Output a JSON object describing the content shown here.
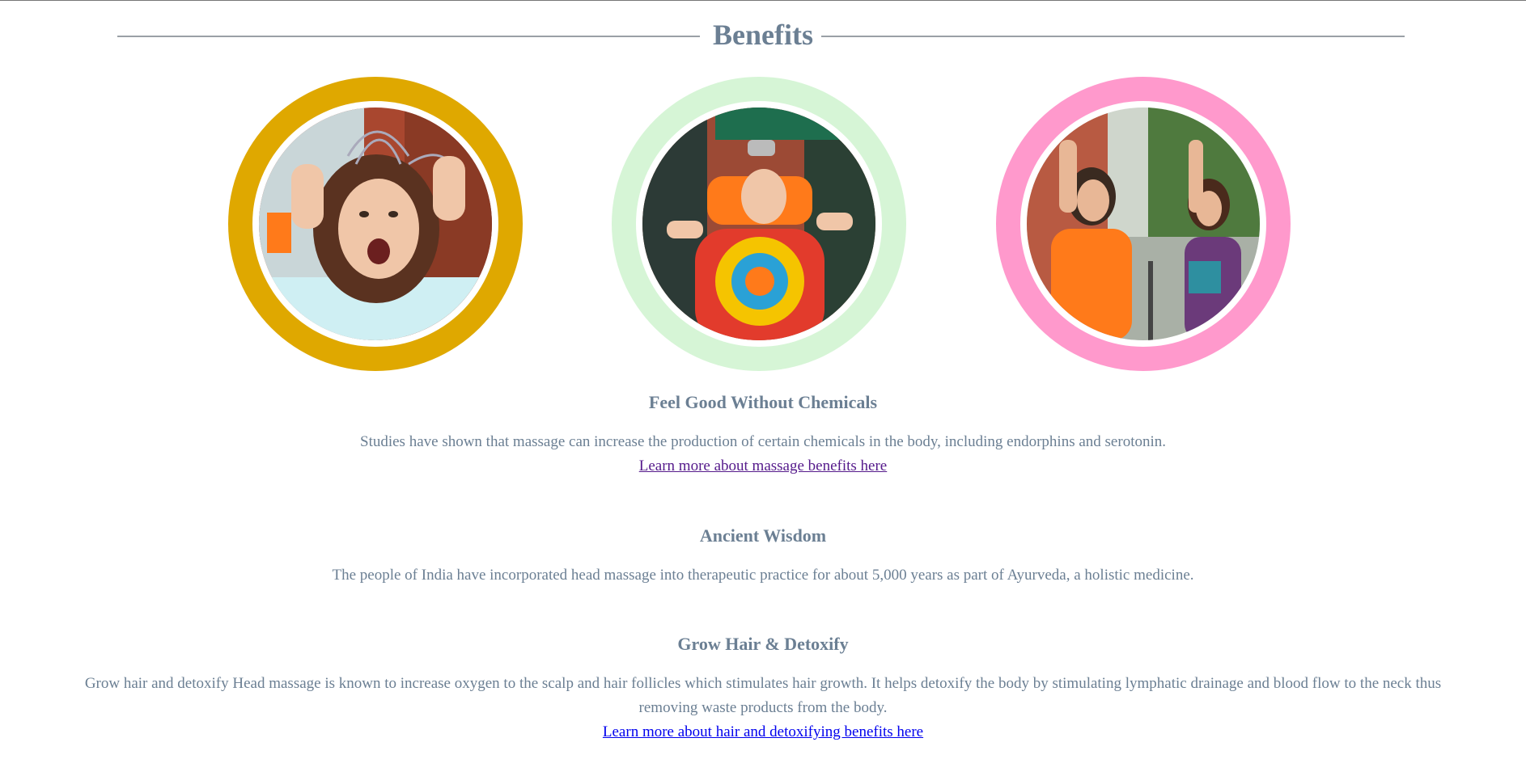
{
  "section": {
    "title": "Benefits"
  },
  "colors": {
    "ring_1": "#dfa800",
    "ring_2": "#d6f5d6",
    "ring_3": "#ff99cc",
    "text": "#6b7f93",
    "visited_link": "#551a8b",
    "link": "#0000ee"
  },
  "benefits": [
    {
      "title": "Feel Good Without Chemicals",
      "text": "Studies have shown that massage can increase the production of certain chemicals in the body, including endorphins and serotonin.",
      "link": "Learn more about massage benefits here"
    },
    {
      "title": "Ancient Wisdom",
      "text": "The people of India have incorporated head massage into therapeutic practice for about 5,000 years as part of Ayurveda, a holistic medicine."
    },
    {
      "title": "Grow Hair & Detoxify",
      "text": "Grow hair and detoxify Head massage is known to increase oxygen to the scalp and hair follicles which stimulates hair growth. It helps detoxify the body by stimulating lymphatic drainage and blood flow to the neck thus removing waste products from the body.",
      "link": "Learn more about hair and detoxifying benefits here"
    }
  ]
}
